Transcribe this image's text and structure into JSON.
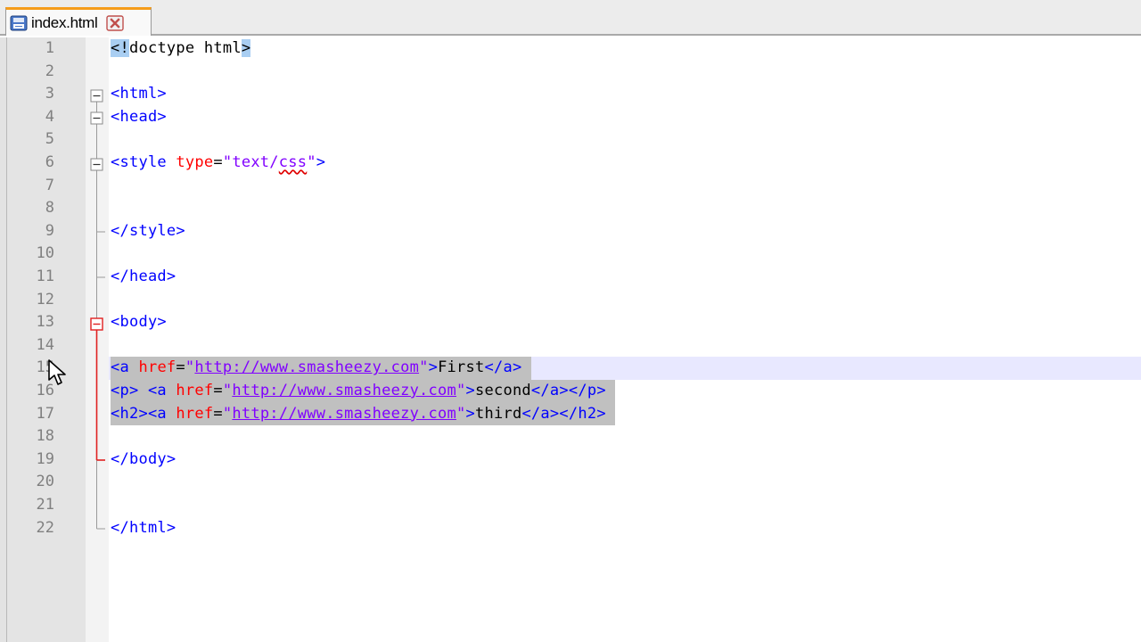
{
  "tab": {
    "title": "index.html",
    "file_icon": "file-icon",
    "close_icon": "close-icon"
  },
  "editor": {
    "line_numbers": [
      "1",
      "2",
      "3",
      "4",
      "5",
      "6",
      "7",
      "8",
      "9",
      "10",
      "11",
      "12",
      "13",
      "14",
      "15",
      "16",
      "17",
      "18",
      "19",
      "20",
      "21",
      "22"
    ],
    "current_line": 15,
    "lines": [
      {
        "n": 1,
        "segs": [
          [
            "match",
            "<!"
          ],
          [
            "txt",
            "doctype html"
          ],
          [
            "match",
            ">"
          ]
        ]
      },
      {
        "n": 2,
        "segs": []
      },
      {
        "n": 3,
        "segs": [
          [
            "t",
            "<html>"
          ]
        ]
      },
      {
        "n": 4,
        "segs": [
          [
            "t",
            "<head>"
          ]
        ]
      },
      {
        "n": 5,
        "segs": []
      },
      {
        "n": 6,
        "segs": [
          [
            "t",
            "<style "
          ],
          [
            "at",
            "type"
          ],
          [
            "txt",
            "="
          ],
          [
            "av",
            "\"text/"
          ],
          [
            "av sq",
            "css"
          ],
          [
            "av",
            "\""
          ],
          [
            "t",
            ">"
          ]
        ]
      },
      {
        "n": 7,
        "segs": []
      },
      {
        "n": 8,
        "segs": []
      },
      {
        "n": 9,
        "segs": [
          [
            "t",
            "</style>"
          ]
        ]
      },
      {
        "n": 10,
        "segs": []
      },
      {
        "n": 11,
        "segs": [
          [
            "t",
            "</head>"
          ]
        ]
      },
      {
        "n": 12,
        "segs": []
      },
      {
        "n": 13,
        "segs": [
          [
            "t",
            "<body>"
          ]
        ]
      },
      {
        "n": 14,
        "segs": []
      },
      {
        "n": 15,
        "sel": true,
        "segs": [
          [
            "t",
            "<a "
          ],
          [
            "at",
            "href"
          ],
          [
            "txt",
            "="
          ],
          [
            "av",
            "\""
          ],
          [
            "url",
            "http://www.smasheezy.com"
          ],
          [
            "av",
            "\""
          ],
          [
            "t",
            ">"
          ],
          [
            "txt",
            "First"
          ],
          [
            "t",
            "</a>"
          ],
          [
            "txt",
            " "
          ]
        ]
      },
      {
        "n": 16,
        "sel": true,
        "segs": [
          [
            "t",
            "<p> <a "
          ],
          [
            "at",
            "href"
          ],
          [
            "txt",
            "="
          ],
          [
            "av",
            "\""
          ],
          [
            "url",
            "http://www.smasheezy.com"
          ],
          [
            "av",
            "\""
          ],
          [
            "t",
            ">"
          ],
          [
            "txt",
            "second"
          ],
          [
            "t",
            "</a></p>"
          ],
          [
            "txt",
            " "
          ]
        ]
      },
      {
        "n": 17,
        "sel": true,
        "segs": [
          [
            "t",
            "<h2><a "
          ],
          [
            "at",
            "href"
          ],
          [
            "txt",
            "="
          ],
          [
            "av",
            "\""
          ],
          [
            "url",
            "http://www.smasheezy.com"
          ],
          [
            "av",
            "\""
          ],
          [
            "t",
            ">"
          ],
          [
            "txt",
            "third"
          ],
          [
            "t",
            "</a></h2>"
          ],
          [
            "txt",
            " "
          ]
        ]
      },
      {
        "n": 18,
        "segs": []
      },
      {
        "n": 19,
        "segs": [
          [
            "t",
            "</body>"
          ]
        ]
      },
      {
        "n": 20,
        "segs": []
      },
      {
        "n": 21,
        "segs": []
      },
      {
        "n": 22,
        "segs": [
          [
            "t",
            "</html>"
          ]
        ]
      }
    ]
  },
  "colors": {
    "tag": "#0000ff",
    "attribute": "#ff0000",
    "value": "#8000ff",
    "text": "#000000",
    "selection": "#c0c0c0",
    "current_line": "#e8e8ff",
    "fold_active": "#e02020",
    "tab_accent": "#f59c1a"
  },
  "cursor_icon": "mouse-pointer-icon"
}
